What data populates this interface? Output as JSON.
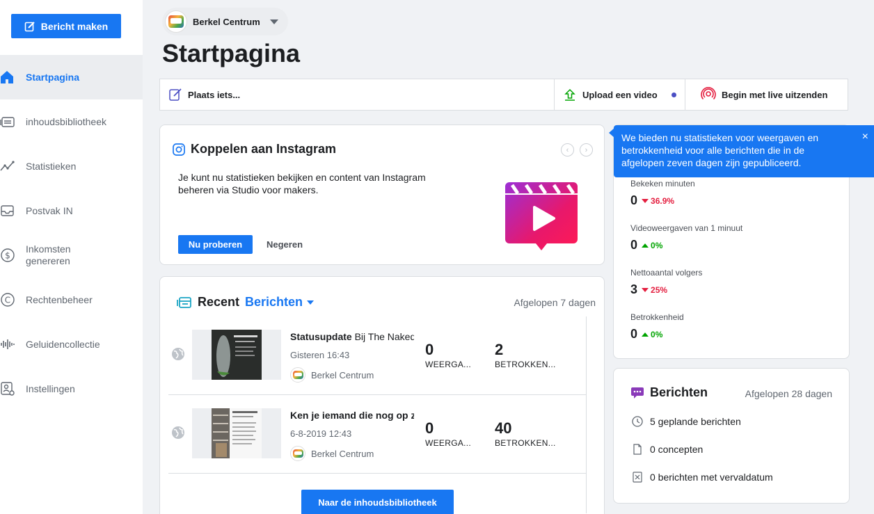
{
  "sidebar": {
    "create_button": "Bericht maken",
    "items": [
      {
        "label": "Startpagina",
        "icon": "home-icon",
        "active": true
      },
      {
        "label": "inhoudsbibliotheek",
        "icon": "library-icon"
      },
      {
        "label": "Statistieken",
        "icon": "insights-icon"
      },
      {
        "label": "Postvak IN",
        "icon": "inbox-icon"
      },
      {
        "label": "Inkomsten genereren",
        "icon": "dollar-icon"
      },
      {
        "label": "Rechtenbeheer",
        "icon": "copyright-icon"
      },
      {
        "label": "Geluidencollectie",
        "icon": "sound-icon"
      },
      {
        "label": "Instellingen",
        "icon": "settings-icon"
      }
    ]
  },
  "header": {
    "page_name": "Berkel Centrum",
    "title": "Startpagina"
  },
  "composer": {
    "post": "Plaats iets...",
    "upload": "Upload een video",
    "live": "Begin met live uitzenden"
  },
  "instagram": {
    "title": "Koppelen aan Instagram",
    "description": "Je kunt nu statistieken bekijken en content van Instagram beheren via Studio voor makers.",
    "try_button": "Nu proberen",
    "ignore_button": "Negeren"
  },
  "recent": {
    "label": "Recent",
    "filter": "Berichten",
    "range": "Afgelopen 7 dagen",
    "posts": [
      {
        "title_bold": "Statusupdate",
        "title_rest": " Bij The Naked",
        "date": "Gisteren 16:43",
        "page": "Berkel Centrum",
        "views": "0",
        "views_label": "WEERGA...",
        "engagement": "2",
        "engagement_label": "BETROKKEN..."
      },
      {
        "title_bold": "Ken je iemand die nog op z",
        "title_rest": "",
        "date": "6-8-2019 12:43",
        "page": "Berkel Centrum",
        "views": "0",
        "views_label": "WEERGA...",
        "engagement": "40",
        "engagement_label": "BETROKKEN..."
      }
    ],
    "library_button": "Naar de inhoudsbibliotheek"
  },
  "tooltip": {
    "text": "We bieden nu statistieken voor weergaven en betrokkenheid voor alle berichten die in de afgelopen zeven dagen zijn gepubliceerd.",
    "close": "×"
  },
  "stats": [
    {
      "label": "Bekeken minuten",
      "value": "0",
      "delta": "36.9%",
      "direction": "down"
    },
    {
      "label": "Videoweergaven van 1 minuut",
      "value": "0",
      "delta": "0%",
      "direction": "up"
    },
    {
      "label": "Nettoaantal volgers",
      "value": "3",
      "delta": "25%",
      "direction": "down"
    },
    {
      "label": "Betrokkenheid",
      "value": "0",
      "delta": "0%",
      "direction": "up"
    }
  ],
  "berichten": {
    "title": "Berichten",
    "range": "Afgelopen 28 dagen",
    "items": [
      {
        "label": "5 geplande berichten",
        "icon": "clock-icon"
      },
      {
        "label": "0 concepten",
        "icon": "draft-icon"
      },
      {
        "label": "0 berichten met vervaldatum",
        "icon": "expired-icon"
      }
    ]
  },
  "colors": {
    "accent": "#1877f2",
    "negative": "#e41e3f",
    "positive": "#00a400"
  }
}
